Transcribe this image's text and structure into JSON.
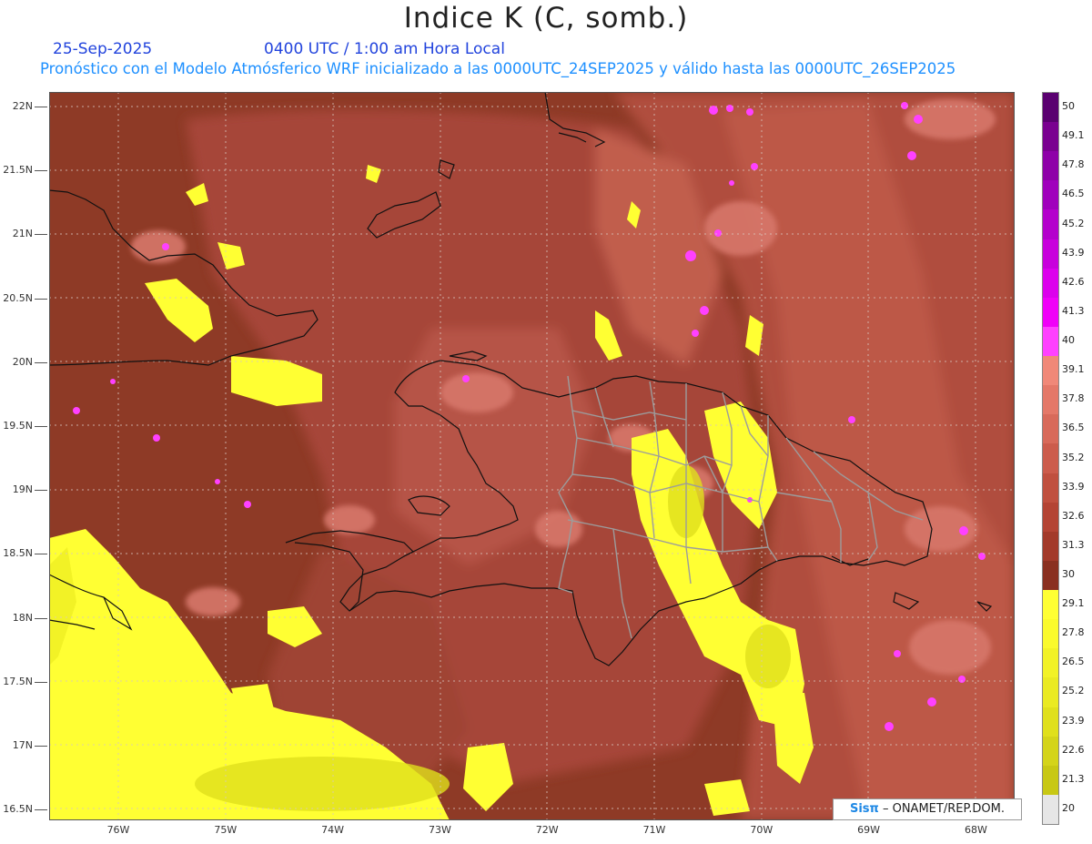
{
  "header": {
    "title": "Indice K (C, somb.)",
    "date": "25-Sep-2025",
    "time": "0400 UTC / 1:00 am Hora Local",
    "subtitle": "Pronóstico con el Modelo Atmósferico WRF inicializado a las 0000UTC_24SEP2025 y válido hasta las  0000UTC_26SEP2025"
  },
  "axes": {
    "lat_labels": [
      "22N",
      "21.5N",
      "21N",
      "20.5N",
      "20N",
      "19.5N",
      "19N",
      "18.5N",
      "18N",
      "17.5N",
      "17N",
      "16.5N"
    ],
    "lon_labels": [
      "76W",
      "75W",
      "74W",
      "73W",
      "72W",
      "71W",
      "70W",
      "69W",
      "68W"
    ]
  },
  "legend": {
    "values": [
      "50",
      "49.1",
      "47.8",
      "46.5",
      "45.2",
      "43.9",
      "42.6",
      "41.3",
      "40",
      "39.1",
      "37.8",
      "36.5",
      "35.2",
      "33.9",
      "32.6",
      "31.3",
      "30",
      "29.1",
      "27.8",
      "26.5",
      "25.2",
      "23.9",
      "22.6",
      "21.3",
      "20"
    ],
    "colors": [
      "#5a0070",
      "#7a0090",
      "#8e00a8",
      "#a000bc",
      "#b400cc",
      "#c800dc",
      "#dc00ec",
      "#f000f8",
      "#ff40ff",
      "#f08878",
      "#e47868",
      "#d86a5a",
      "#cc5c4c",
      "#c0503f",
      "#b44434",
      "#a33a2a",
      "#8a3020",
      "#ffff33",
      "#fafa2c",
      "#f2f226",
      "#eaea22",
      "#e0e01c",
      "#d4d41a",
      "#c8c814",
      "#e6e6e6"
    ]
  },
  "credit": {
    "brand": "Sisπ",
    "text": "– ONAMET/REP.DOM."
  }
}
